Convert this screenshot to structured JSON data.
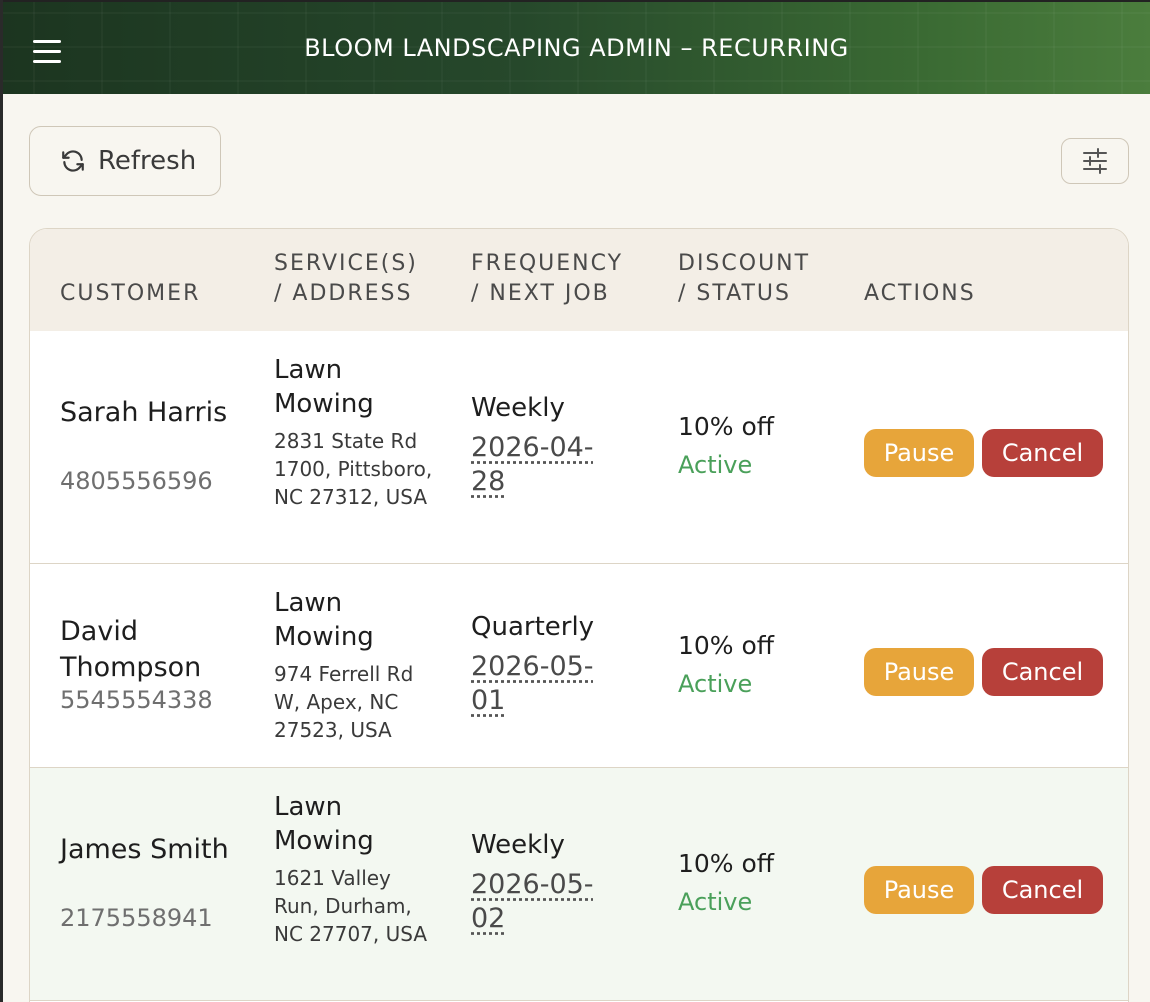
{
  "header": {
    "title": "BLOOM LANDSCAPING ADMIN – RECURRING",
    "menu_icon": "hamburger-menu-icon"
  },
  "toolbar": {
    "refresh_label": "Refresh",
    "refresh_icon": "refresh-icon",
    "filter_icon": "sliders-icon"
  },
  "table": {
    "columns": [
      [
        "CUSTOMER"
      ],
      [
        "SERVICE(S)",
        "/ ADDRESS"
      ],
      [
        "FREQUENCY",
        "/ NEXT JOB"
      ],
      [
        "DISCOUNT",
        "/ STATUS"
      ],
      [
        "ACTIONS"
      ]
    ],
    "rows": [
      {
        "name": "Sarah Harris",
        "phone": "4805556596",
        "service": "Lawn Mowing",
        "address": "2831 State Rd 1700, Pittsboro, NC 27312, USA",
        "frequency": "Weekly",
        "next_job": "2026-04-28",
        "discount": "10% off",
        "status": "Active",
        "pause_label": "Pause",
        "cancel_label": "Cancel"
      },
      {
        "name": "David Thompson",
        "phone": "5545554338",
        "service": "Lawn Mowing",
        "address": "974 Ferrell Rd W, Apex, NC 27523, USA",
        "frequency": "Quarterly",
        "next_job": "2026-05-01",
        "discount": "10% off",
        "status": "Active",
        "pause_label": "Pause",
        "cancel_label": "Cancel"
      },
      {
        "name": "James Smith",
        "phone": "2175558941",
        "service": "Lawn Mowing",
        "address": "1621 Valley Run, Durham, NC 27707, USA",
        "frequency": "Weekly",
        "next_job": "2026-05-02",
        "discount": "10% off",
        "status": "Active",
        "pause_label": "Pause",
        "cancel_label": "Cancel"
      }
    ]
  },
  "colors": {
    "header_dark": "#1c3520",
    "header_light": "#4b7d3d",
    "status_active": "#4aa05a",
    "pause_button": "#e7a53a",
    "cancel_button": "#b7403a"
  }
}
